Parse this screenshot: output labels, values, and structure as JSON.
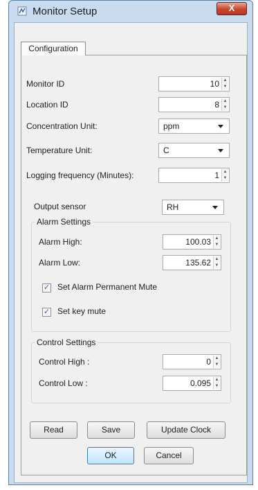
{
  "window": {
    "title": "Monitor Setup",
    "close_label": "X",
    "tabs": [
      "Configuration"
    ]
  },
  "fields": {
    "monitor_id": {
      "label": "Monitor ID",
      "value": "10"
    },
    "location_id": {
      "label": "Location ID",
      "value": "8"
    },
    "concentration_unit": {
      "label": "Concentration Unit:",
      "value": "ppm"
    },
    "temperature_unit": {
      "label": "Temperature Unit:",
      "value": "C"
    },
    "logging_frequency": {
      "label": "Logging frequency (Minutes):",
      "value": "1"
    },
    "output_sensor": {
      "label": "Output sensor",
      "value": "RH"
    }
  },
  "alarm": {
    "title": "Alarm Settings",
    "high": {
      "label": "Alarm High:",
      "value": "100.03"
    },
    "low": {
      "label": "Alarm Low:",
      "value": "135.62"
    },
    "permanent_mute": {
      "label": "Set Alarm Permanent Mute",
      "checked": true
    },
    "key_mute": {
      "label": "Set key mute",
      "checked": true
    }
  },
  "control": {
    "title": "Control Settings",
    "high": {
      "label": "Control High :",
      "value": "0"
    },
    "low": {
      "label": "Control Low :",
      "value": "0.095"
    }
  },
  "buttons": {
    "read": "Read",
    "save": "Save",
    "update_clock": "Update Clock",
    "ok": "OK",
    "cancel": "Cancel"
  },
  "icons": {
    "app": "monitor-app-icon",
    "close": "close-icon",
    "spin": "spin-arrows-icon",
    "dropdown": "chevron-down-icon",
    "check": "checkmark-icon"
  },
  "colors": {
    "frame": "#c9dcef",
    "close": "#c7452f",
    "panel": "#f0f0f0"
  }
}
